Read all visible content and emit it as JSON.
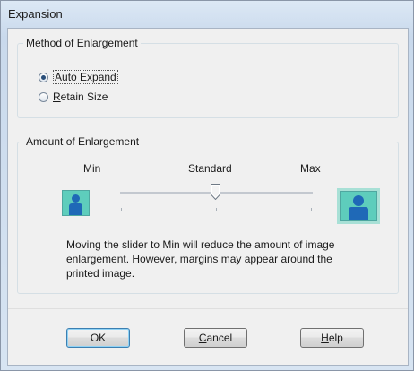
{
  "window": {
    "title": "Expansion"
  },
  "method_group": {
    "title": "Method of Enlargement",
    "options": [
      {
        "label": "Auto Expand",
        "selected": true
      },
      {
        "label": "Retain Size",
        "selected": false
      }
    ]
  },
  "amount_group": {
    "title": "Amount of Enlargement",
    "min_label": "Min",
    "standard_label": "Standard",
    "max_label": "Max",
    "slider_value": "Standard",
    "description": "Moving the slider to Min will reduce the amount of image enlargement. However, margins may appear around the printed image."
  },
  "buttons": {
    "ok": "OK",
    "cancel": "Cancel",
    "help": "Help"
  },
  "colors": {
    "accent": "#1f69b7",
    "thumbnail_bg": "#5ecdbc"
  },
  "icons": {
    "min_preview": "person-thumbnail-icon",
    "max_preview": "person-thumbnail-icon"
  }
}
